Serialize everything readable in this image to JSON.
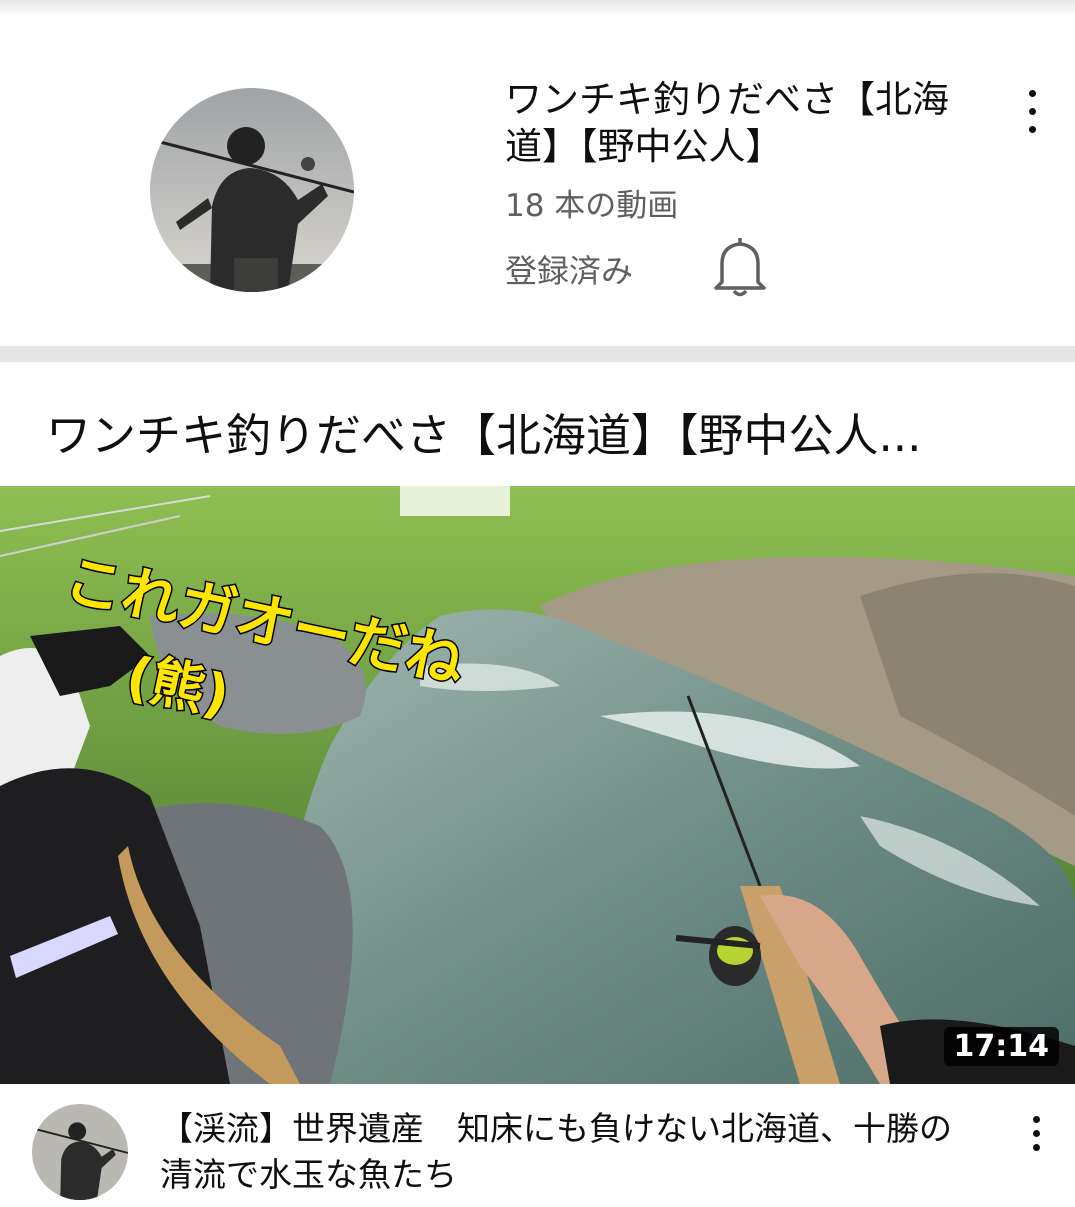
{
  "channel": {
    "name": "ワンチキ釣りだべさ【北海道】【野中公人】",
    "video_count": "18 本の動画",
    "subscribe_status": "登録済み"
  },
  "playlist": {
    "title": "ワンチキ釣りだべさ【北海道】【野中公人..."
  },
  "video": {
    "duration": "17:14",
    "overlay_text_main": "これガオーだね",
    "overlay_text_sub": "(熊)",
    "title": "【渓流】世界遺産　知床にも負けない北海道、十勝の清流で水玉な魚たち"
  },
  "icons": {
    "bell": "bell-icon",
    "more": "more-vert-icon"
  },
  "colors": {
    "secondary_text": "#606060",
    "divider": "#e5e5e5",
    "overlay_text": "#ffe600"
  }
}
